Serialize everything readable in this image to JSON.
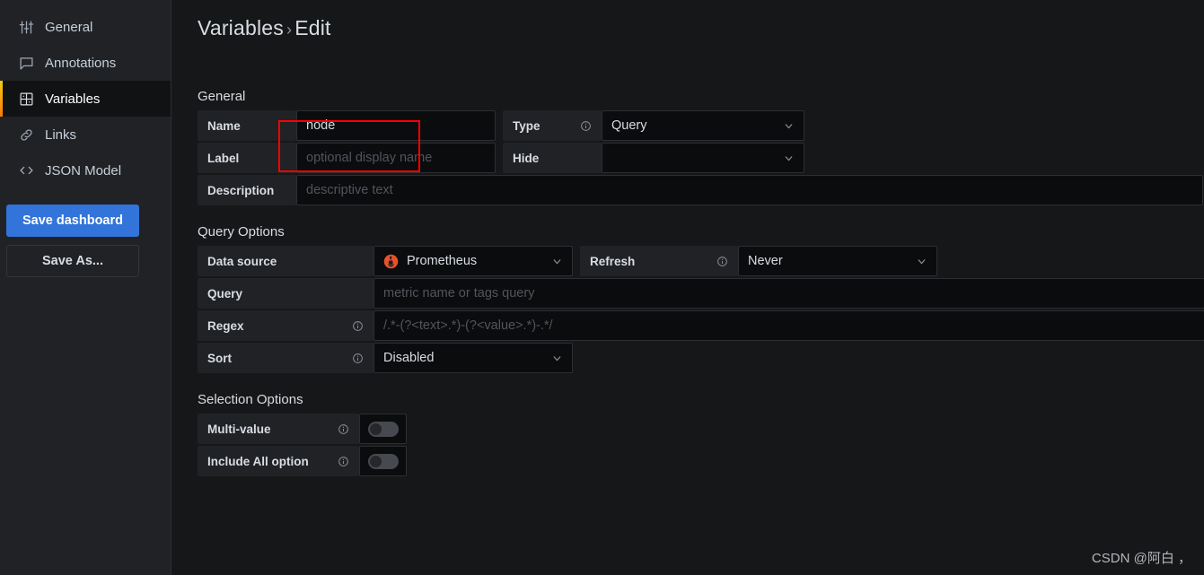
{
  "sidebar": {
    "items": [
      {
        "label": "General",
        "icon": "sliders-icon"
      },
      {
        "label": "Annotations",
        "icon": "speech-bubble-icon"
      },
      {
        "label": "Variables",
        "icon": "table-grid-icon"
      },
      {
        "label": "Links",
        "icon": "link-chain-icon"
      },
      {
        "label": "JSON Model",
        "icon": "code-brackets-icon"
      }
    ],
    "save_dashboard_label": "Save dashboard",
    "save_as_label": "Save As...",
    "save_button_color": "#3274d9",
    "active_indicator_color": "#ff780a"
  },
  "header": {
    "breadcrumb_root": "Variables",
    "breadcrumb_separator": "›",
    "breadcrumb_current": "Edit"
  },
  "general": {
    "section_label": "General",
    "name": {
      "label": "Name",
      "value": "node"
    },
    "type": {
      "label": "Type",
      "info_icon": "info-circle-icon",
      "value": "Query"
    },
    "label_field": {
      "label": "Label",
      "placeholder": "optional display name",
      "value": ""
    },
    "hide": {
      "label": "Hide",
      "value": ""
    },
    "description": {
      "label": "Description",
      "placeholder": "descriptive text",
      "value": ""
    }
  },
  "query_options": {
    "section_label": "Query Options",
    "data_source": {
      "label": "Data source",
      "value": "Prometheus",
      "icon": "prometheus-icon"
    },
    "refresh": {
      "label": "Refresh",
      "info_icon": "info-circle-icon",
      "value": "Never"
    },
    "query": {
      "label": "Query",
      "placeholder": "metric name or tags query",
      "value": ""
    },
    "regex": {
      "label": "Regex",
      "info_icon": "info-circle-icon",
      "placeholder": "/.*-(?<text>.*)-(?<value>.*)-.*/",
      "value": ""
    },
    "sort": {
      "label": "Sort",
      "info_icon": "info-circle-icon",
      "value": "Disabled"
    }
  },
  "selection_options": {
    "section_label": "Selection Options",
    "multi_value": {
      "label": "Multi-value",
      "info_icon": "info-circle-icon",
      "enabled": false
    },
    "include_all": {
      "label": "Include All option",
      "info_icon": "info-circle-icon",
      "enabled": false
    }
  },
  "annotation": {
    "highlight_color": "#ff0000"
  },
  "watermark": {
    "text": "CSDN @阿白 ，"
  }
}
